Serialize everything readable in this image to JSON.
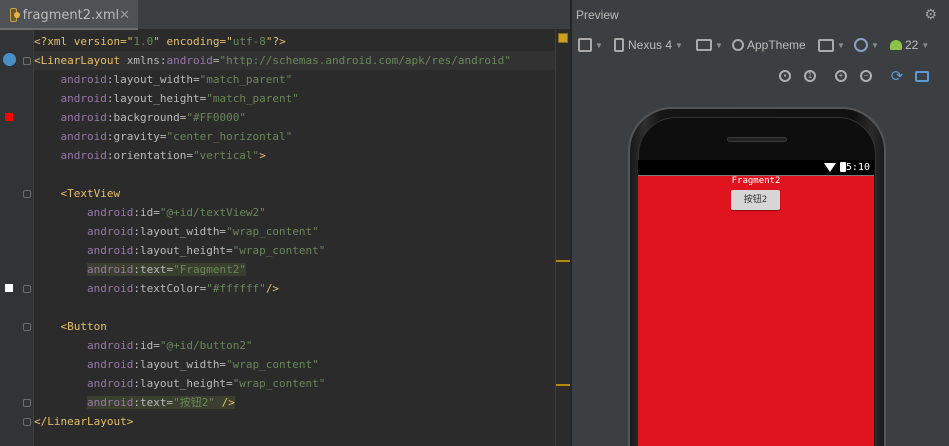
{
  "editor": {
    "tab_label": "fragment2.xml",
    "lines": [
      {
        "t": [
          [
            "tag",
            "<?xml version=\""
          ],
          [
            "val",
            "1.0"
          ],
          [
            "tag",
            "\" encoding=\""
          ],
          [
            "val",
            "utf-8"
          ],
          [
            "tag",
            "\"?>"
          ]
        ]
      },
      {
        "t": [
          [
            "tag",
            "<LinearLayout "
          ],
          [
            "attr",
            "xmlns:"
          ],
          [
            "ns",
            "android"
          ],
          [
            "attr",
            "="
          ],
          [
            "val",
            "\"http://schemas.android.com/apk/res/android\""
          ]
        ]
      },
      {
        "t": [
          [
            "plain",
            "    "
          ],
          [
            "ns",
            "android"
          ],
          [
            "attr",
            ":layout_width="
          ],
          [
            "val",
            "\"match_parent\""
          ]
        ]
      },
      {
        "t": [
          [
            "plain",
            "    "
          ],
          [
            "ns",
            "android"
          ],
          [
            "attr",
            ":layout_height="
          ],
          [
            "val",
            "\"match_parent\""
          ]
        ]
      },
      {
        "t": [
          [
            "plain",
            "    "
          ],
          [
            "ns",
            "android"
          ],
          [
            "attr",
            ":background="
          ],
          [
            "val",
            "\"#FF0000\""
          ]
        ]
      },
      {
        "t": [
          [
            "plain",
            "    "
          ],
          [
            "ns",
            "android"
          ],
          [
            "attr",
            ":gravity="
          ],
          [
            "val",
            "\"center_horizontal\""
          ]
        ]
      },
      {
        "t": [
          [
            "plain",
            "    "
          ],
          [
            "ns",
            "android"
          ],
          [
            "attr",
            ":orientation="
          ],
          [
            "val",
            "\"vertical\""
          ],
          [
            "tag",
            ">"
          ]
        ]
      },
      {
        "t": [
          [
            "plain",
            ""
          ]
        ]
      },
      {
        "t": [
          [
            "plain",
            "    "
          ],
          [
            "tag",
            "<TextView"
          ]
        ]
      },
      {
        "t": [
          [
            "plain",
            "        "
          ],
          [
            "ns",
            "android"
          ],
          [
            "attr",
            ":id="
          ],
          [
            "val",
            "\"@+id/textView2\""
          ]
        ]
      },
      {
        "t": [
          [
            "plain",
            "        "
          ],
          [
            "ns",
            "android"
          ],
          [
            "attr",
            ":layout_width="
          ],
          [
            "val",
            "\"wrap_content\""
          ]
        ]
      },
      {
        "t": [
          [
            "plain",
            "        "
          ],
          [
            "ns",
            "android"
          ],
          [
            "attr",
            ":layout_height="
          ],
          [
            "val",
            "\"wrap_content\""
          ]
        ]
      },
      {
        "t": [
          [
            "plain",
            "        "
          ],
          [
            "ns",
            "android"
          ],
          [
            "attr",
            ":text="
          ],
          [
            "val",
            "\"Fragment2\""
          ]
        ]
      },
      {
        "t": [
          [
            "plain",
            "        "
          ],
          [
            "ns",
            "android"
          ],
          [
            "attr",
            ":textColor="
          ],
          [
            "val",
            "\"#ffffff\""
          ],
          [
            "tag",
            "/>"
          ]
        ]
      },
      {
        "t": [
          [
            "plain",
            ""
          ]
        ]
      },
      {
        "t": [
          [
            "plain",
            "    "
          ],
          [
            "tag",
            "<Button"
          ]
        ]
      },
      {
        "t": [
          [
            "plain",
            "        "
          ],
          [
            "ns",
            "android"
          ],
          [
            "attr",
            ":id="
          ],
          [
            "val",
            "\"@+id/button2\""
          ]
        ]
      },
      {
        "t": [
          [
            "plain",
            "        "
          ],
          [
            "ns",
            "android"
          ],
          [
            "attr",
            ":layout_width="
          ],
          [
            "val",
            "\"wrap_content\""
          ]
        ]
      },
      {
        "t": [
          [
            "plain",
            "        "
          ],
          [
            "ns",
            "android"
          ],
          [
            "attr",
            ":layout_height="
          ],
          [
            "val",
            "\"wrap_content\""
          ]
        ]
      },
      {
        "t": [
          [
            "plain",
            "        "
          ],
          [
            "ns",
            "android"
          ],
          [
            "attr",
            ":text="
          ],
          [
            "val",
            "\"按钮2\""
          ],
          [
            "tag",
            " />"
          ]
        ]
      },
      {
        "t": [
          [
            "tag",
            "</LinearLayout>"
          ]
        ]
      }
    ]
  },
  "preview": {
    "title": "Preview",
    "device": "Nexus 4",
    "theme": "AppTheme",
    "api_level": "22",
    "status_time": "5:10",
    "textview_text": "Fragment2",
    "button_text": "按钮2",
    "background_color": "#e0141e"
  }
}
